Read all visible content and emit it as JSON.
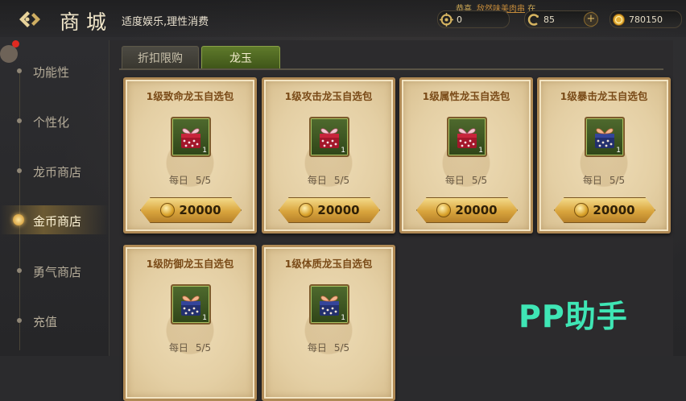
{
  "header": {
    "title": "商城",
    "subtitle": "适度娱乐,理性消费",
    "notice_prefix": "恭喜",
    "notice_name": "敌然味美肉串",
    "notice_suffix": "在",
    "currencies": [
      {
        "icon": "target-icon",
        "value": "0"
      },
      {
        "icon": "dragon-coin-icon",
        "value": "85"
      },
      {
        "icon": "gold-coin-icon",
        "value": "780150"
      }
    ]
  },
  "nav": {
    "items": [
      {
        "label": "功能性",
        "active": false
      },
      {
        "label": "个性化",
        "active": false
      },
      {
        "label": "龙币商店",
        "active": false
      },
      {
        "label": "金币商店",
        "active": true
      },
      {
        "label": "勇气商店",
        "active": false
      },
      {
        "label": "充值",
        "active": false
      }
    ]
  },
  "tabs": [
    {
      "label": "折扣限购",
      "active": false
    },
    {
      "label": "龙玉",
      "active": true
    }
  ],
  "products": [
    {
      "title": "1级致命龙玉自选包",
      "daily_label": "每日",
      "daily_value": "5/5",
      "price": "20000",
      "quantity": "1",
      "gift_color": "red"
    },
    {
      "title": "1级攻击龙玉自选包",
      "daily_label": "每日",
      "daily_value": "5/5",
      "price": "20000",
      "quantity": "1",
      "gift_color": "red"
    },
    {
      "title": "1级属性龙玉自选包",
      "daily_label": "每日",
      "daily_value": "5/5",
      "price": "20000",
      "quantity": "1",
      "gift_color": "red"
    },
    {
      "title": "1级暴击龙玉自选包",
      "daily_label": "每日",
      "daily_value": "5/5",
      "price": "20000",
      "quantity": "1",
      "gift_color": "blue"
    },
    {
      "title": "1级防御龙玉自选包",
      "daily_label": "每日",
      "daily_value": "5/5",
      "price": "",
      "quantity": "1",
      "gift_color": "blue"
    },
    {
      "title": "1级体质龙玉自选包",
      "daily_label": "每日",
      "daily_value": "5/5",
      "price": "",
      "quantity": "1",
      "gift_color": "blue"
    }
  ],
  "watermark": "PP助手",
  "colors": {
    "accent_gold": "#d9a53d",
    "tab_active": "#5f7a2b",
    "card_bg": "#e4cfa4",
    "title_brown": "#7a4b18",
    "notice_orange": "#c38a3a",
    "watermark": "#3fe6b5"
  }
}
